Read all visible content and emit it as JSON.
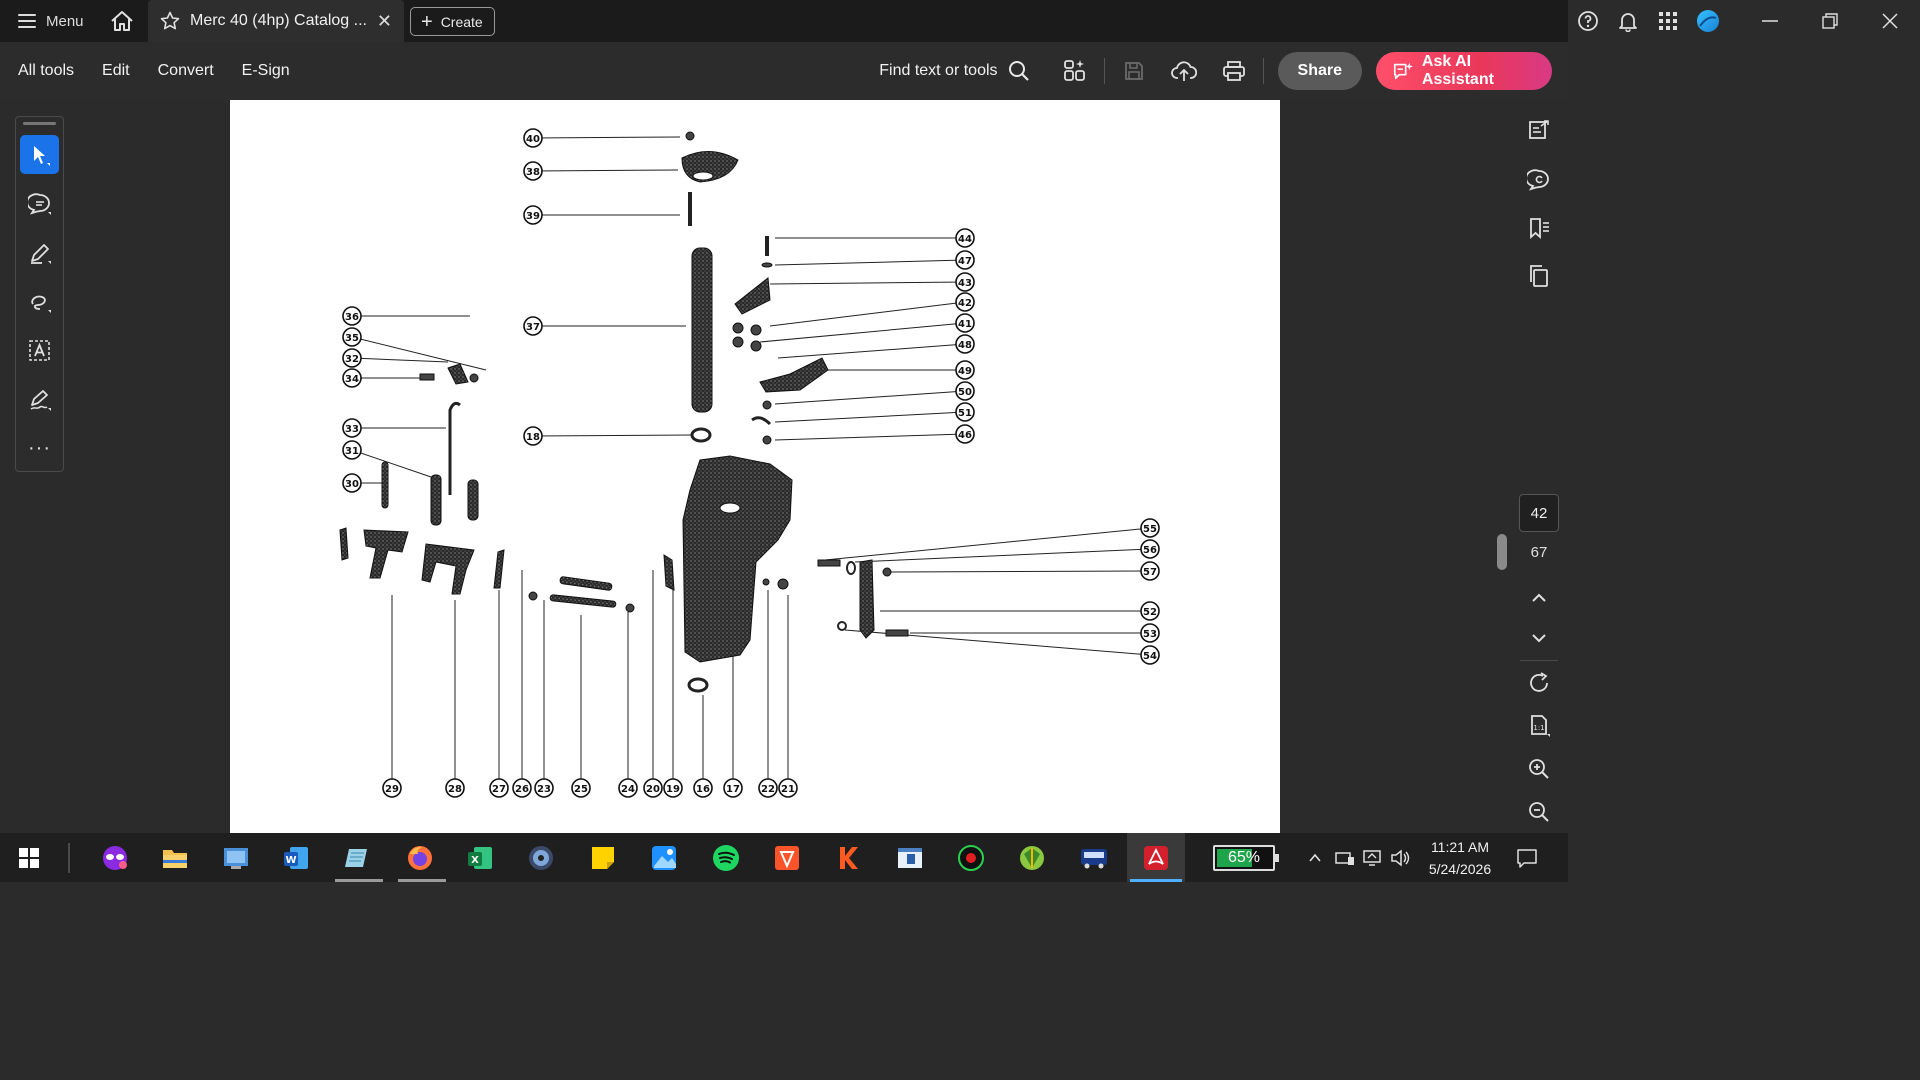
{
  "titlebar": {
    "menu_label": "Menu",
    "tab_title": "Merc 40 (4hp) Catalog ...",
    "tab_close_glyph": "✕",
    "create_label": "Create",
    "icons": [
      "help-icon",
      "bell-icon",
      "apps-grid-icon",
      "profile-avatar"
    ],
    "window_controls": [
      "minimize",
      "restore",
      "close"
    ]
  },
  "toolbar": {
    "menu_items": [
      "All tools",
      "Edit",
      "Convert",
      "E-Sign"
    ],
    "find_label": "Find text or tools",
    "share_label": "Share",
    "ai_label": "Ask AI Assistant",
    "accent_color": "#e9375a"
  },
  "left_tools": {
    "items": [
      "select-arrow",
      "comment",
      "highlight-pen",
      "draw-freeform",
      "text-select",
      "edit-signature",
      "more"
    ],
    "more_glyph": "···",
    "active": "select-arrow",
    "active_color": "#1a73e8"
  },
  "right_rail": {
    "current_page": "42",
    "total_pages": "67"
  },
  "diagram": {
    "callouts": {
      "top_center": [
        "40",
        "38",
        "39",
        "37",
        "18"
      ],
      "right_upper": [
        "44",
        "47",
        "43",
        "42",
        "41",
        "48",
        "49",
        "50",
        "51",
        "46"
      ],
      "left_upper": [
        "36",
        "35",
        "32",
        "34",
        "33",
        "31",
        "30"
      ],
      "right_lower": [
        "55",
        "56",
        "57",
        "52",
        "53",
        "54"
      ],
      "bottom_row": [
        "29",
        "28",
        "27",
        "26",
        "23",
        "25",
        "24",
        "20",
        "19",
        "16",
        "17",
        "22",
        "21"
      ]
    }
  },
  "taskbar": {
    "battery_percent": "65%",
    "battery_level": 0.65,
    "time": "11:21 AM",
    "date": "5/24/2026"
  }
}
